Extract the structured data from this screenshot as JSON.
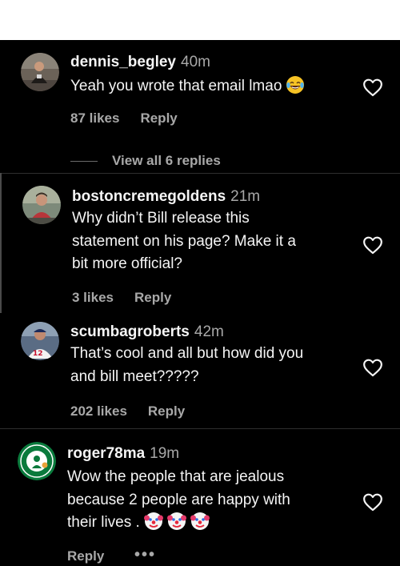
{
  "colors": {
    "background": "#000000",
    "primary_text": "#f5f5f5",
    "secondary_text": "#a8a8a8",
    "separator": "#2f2f2f"
  },
  "comments": [
    {
      "username": "dennis_begley",
      "time": "40m",
      "lines": [
        "Yeah you wrote that email lmao"
      ],
      "emoji": "face-with-tears-of-joy",
      "likes": "87 likes",
      "reply": "Reply",
      "view_replies": "View all 6 replies",
      "icon": "heart-outline-icon"
    },
    {
      "username": "bostoncremegoldens",
      "time": "21m",
      "lines": [
        "Why didn’t Bill release this",
        "statement on his page? Make it a",
        "bit more official?"
      ],
      "likes": "3 likes",
      "reply": "Reply",
      "icon": "heart-outline-icon"
    },
    {
      "username": "scumbagroberts",
      "time": "42m",
      "lines": [
        "That’s cool and all but how did you",
        "and bill meet?????"
      ],
      "likes": "202 likes",
      "reply": "Reply",
      "icon": "heart-outline-icon"
    },
    {
      "username": "roger78ma",
      "time": "19m",
      "lines": [
        "Wow the people that are jealous",
        "because 2 people are happy with",
        "their lives ."
      ],
      "emoji": "clown-face",
      "reply": "Reply",
      "more": "•••",
      "icon": "heart-outline-icon"
    }
  ]
}
